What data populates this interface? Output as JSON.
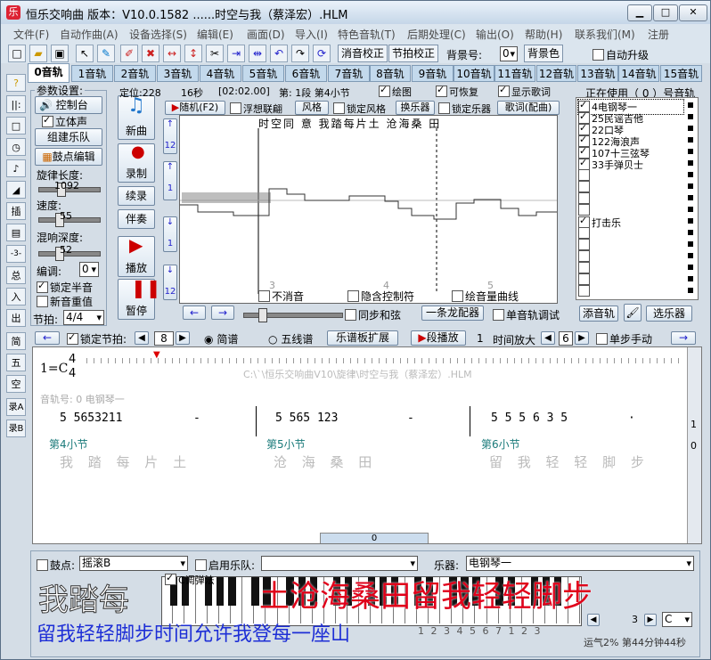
{
  "app": {
    "title": "恒乐交响曲  版本：V10.0.1582  ......时空与我（蔡泽宏）.HLM",
    "icon_letter": "乐"
  },
  "window_controls": [
    "▁",
    "□",
    "✕"
  ],
  "menu": [
    "文件(F)",
    "自动作曲(A)",
    "设备选择(S)",
    "编辑(E)",
    "画面(D)",
    "导入(I)",
    "特色音轨(T)",
    "后期处理(C)",
    "输出(O)",
    "帮助(H)",
    "联系我们(M)",
    "注册"
  ],
  "toolbar": {
    "icons": [
      "new-file-icon",
      "open-folder-icon",
      "save-icon",
      "cursor-icon",
      "pencil-icon",
      "pen-icon",
      "eraser-icon",
      "arrow-h-icon",
      "arrow-v-icon",
      "cut-icon",
      "vline-icon",
      "hline-icon",
      "undo-icon",
      "redo-icon",
      "loop-icon"
    ],
    "btn_pitch": "消音校正",
    "btn_beat": "节拍校正",
    "bg_label": "背景号:",
    "bg_value": "0",
    "bg_color": "背景色",
    "auto_upgrade": "自动升级"
  },
  "tracks": [
    "0音轨",
    "1音轨",
    "2音轨",
    "3音轨",
    "4音轨",
    "5音轨",
    "6音轨",
    "7音轨",
    "8音轨",
    "9音轨",
    "10音轨",
    "11音轨",
    "12音轨",
    "13音轨",
    "14音轨",
    "15音轨"
  ],
  "left_icons": [
    "?",
    "||:",
    "□",
    "◷",
    "♪",
    "◢",
    "插",
    "▤",
    "-3-",
    "总",
    "入",
    "出",
    "简",
    "五",
    "空",
    "录A",
    "录B"
  ],
  "params": {
    "title": "参数设置:",
    "control_panel": "控制台",
    "stereo": "立体声",
    "build_band": "组建乐队",
    "drum_edit": "鼓点编辑",
    "melody_len_label": "旋律长度:",
    "melody_len": "1092",
    "speed_label": "速度:",
    "speed": "55",
    "reverb_label": "混响深度:",
    "reverb": "52",
    "transpose_label": "编调:",
    "transpose": "0",
    "lock_half": "锁定半音",
    "new_rhythm": "新音重值",
    "beat_label": "节拍:",
    "beat": "4/4"
  },
  "center_controls": {
    "new_song": "新曲",
    "record": "录制",
    "continue": "续录",
    "accompany": "伴奏",
    "play": "播放",
    "pause": "暂停"
  },
  "status_bar": {
    "position": "定位:228",
    "seconds": "16秒",
    "time": "[02:02.00]",
    "section": "第: 1段  第4小节",
    "draw_graph": "绘图",
    "recoverable": "可恢复",
    "show_lyrics": "显示歌词"
  },
  "graph_toolbar": {
    "random": "随机(F2)",
    "imagine": "浮想联翩",
    "style": "风格",
    "lock_style": "锁定风格",
    "swap_instrument": "换乐器",
    "lock_instrument": "锁定乐器",
    "lyrics": "歌词(配曲)"
  },
  "graph": {
    "lyric_top": "时空同   意          我踏每片土          沧海桑   田",
    "bar_labels": [
      "3",
      "4",
      "5"
    ],
    "side_labels": [
      "12",
      "1",
      "1",
      "12"
    ],
    "no_mute": "不消音",
    "hide_ctrl": "隐含控制符",
    "draw_curve": "绘音量曲线"
  },
  "under_graph": {
    "sync_chord": "同步和弦",
    "one_dragon": "一条龙配器",
    "single_debug": "单音轨调试"
  },
  "in_use": {
    "title": "正在使用（ 0 ）号音轨",
    "items": [
      "4电钢琴一",
      "25民谣吉他",
      "22口琴",
      "122海浪声",
      "107十三弦琴",
      "33手弹贝士",
      "",
      "",
      "",
      "",
      "打击乐",
      "",
      "",
      "",
      "",
      "",
      ""
    ],
    "checked": [
      true,
      true,
      true,
      true,
      true,
      true,
      false,
      false,
      false,
      false,
      true,
      false,
      false,
      false,
      false,
      false,
      false
    ],
    "add_track": "添音轨",
    "choose_instrument": "选乐器"
  },
  "score_bar": {
    "lock_beat": "锁定节拍:",
    "beat_value": "8",
    "jianpu": "简谱",
    "staff": "五线谱",
    "expand": "乐谱板扩展",
    "segment_play": "段播放",
    "seg_num": "1",
    "time_zoom": "时间放大",
    "zoom_value": "6",
    "single_manual": "单步手动"
  },
  "score": {
    "key": "1=C",
    "ts_top": "4",
    "ts_bot": "4",
    "path": "C:\\`\\恒乐交响曲V10\\旋律\\时空与我（蔡泽宏）.HLM",
    "track_label": "音轨号: 0 电钢琴一",
    "bar1_notes": "5  5653211",
    "bar1_dash": "-",
    "bar2_notes": "5  565  123",
    "bar2_dash": "-",
    "bar3_notes": "5  5  5  6  3  5",
    "bar3_dot": "·",
    "bar_labels": [
      "第4小节",
      "第5小节",
      "第6小节"
    ],
    "lyrics": [
      "我 踏 每 片 土",
      "沧 海 桑   田",
      "留 我 轻 轻 脚 步"
    ],
    "right_numbers": [
      "1",
      "0"
    ],
    "hscroll_value": "0"
  },
  "bottom": {
    "drum_label": "鼓点:",
    "drum_value": "摇滚B",
    "enable_band": "启用乐队:",
    "instrument_label": "乐器:",
    "instrument_value": "电钢琴一",
    "c_key": "C调弹法",
    "big_white": "我踏每",
    "big_red": "土沧海桑田留我轻轻脚步",
    "blue_lyric": "留我轻轻脚步时间允许我登每一座山",
    "piano_numbers": "1 2 3 4 5 6 7 1 2 3",
    "status": "运气2%  第44分钟44秒",
    "spin_value": "3",
    "key_value": "C"
  }
}
